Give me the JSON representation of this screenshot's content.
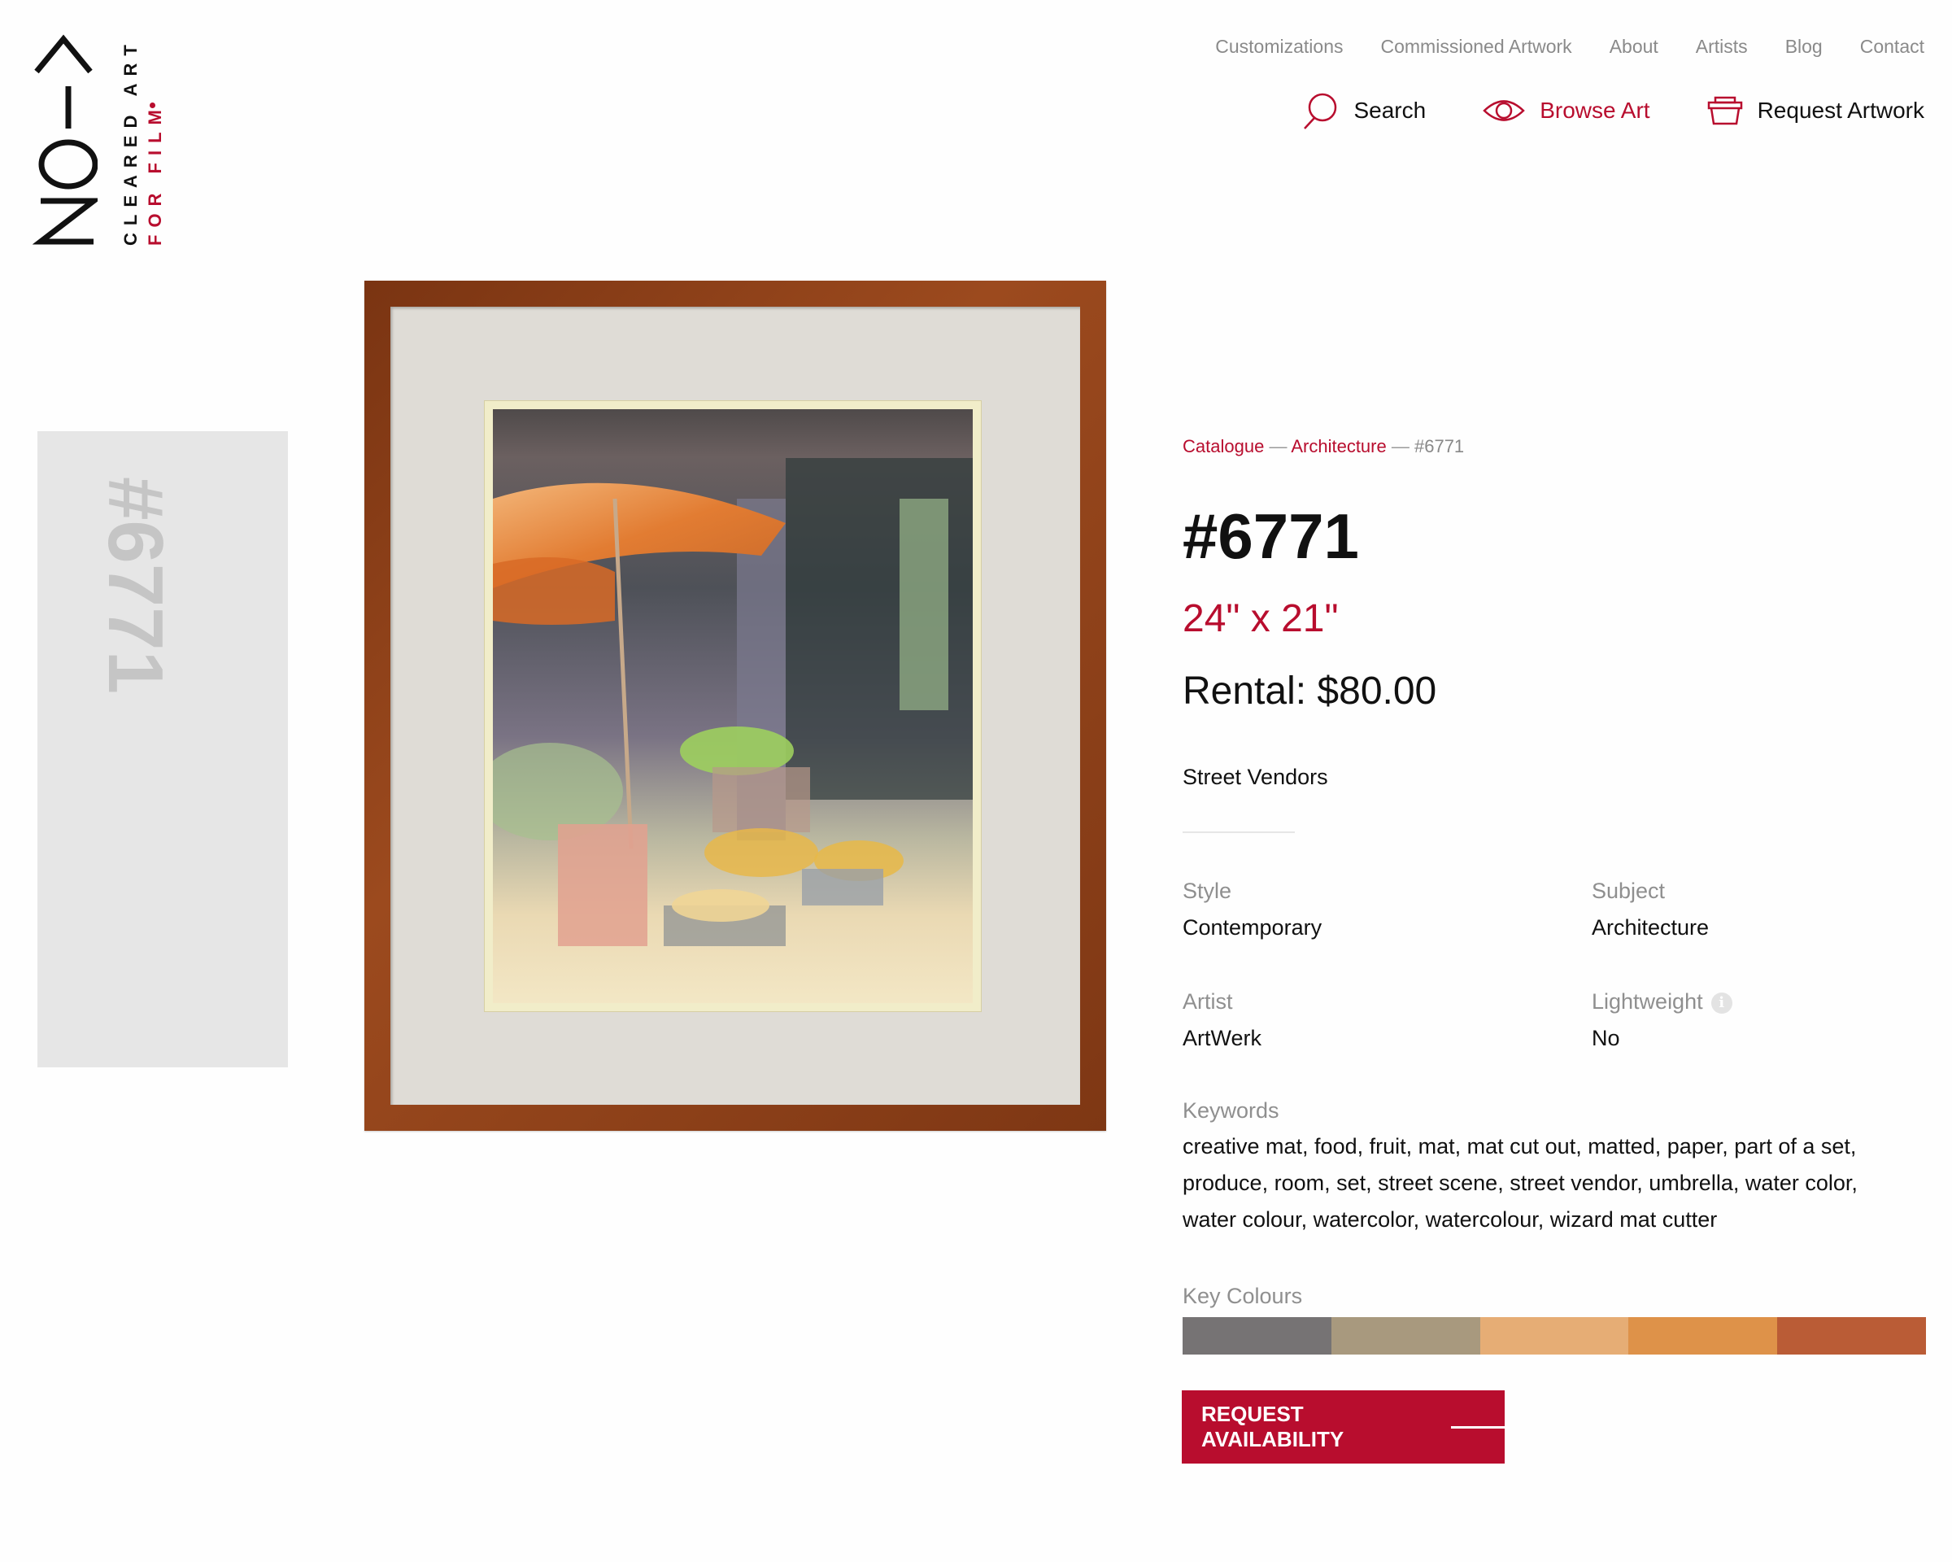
{
  "brand": {
    "tagline_line1": "CLEARED ART",
    "tagline_line2": "FOR FILM",
    "accent_color": "#b80d2e"
  },
  "top_nav": [
    {
      "label": "Customizations"
    },
    {
      "label": "Commissioned Artwork"
    },
    {
      "label": "About"
    },
    {
      "label": "Artists"
    },
    {
      "label": "Blog"
    },
    {
      "label": "Contact"
    }
  ],
  "main_nav": [
    {
      "label": "Search",
      "icon": "search-icon",
      "active": false
    },
    {
      "label": "Browse Art",
      "icon": "eye-icon",
      "active": true
    },
    {
      "label": "Request Artwork",
      "icon": "basket-icon",
      "active": false
    }
  ],
  "side_id": "#6771",
  "breadcrumb": {
    "items": [
      "Catalogue",
      "Architecture"
    ],
    "separator": "—",
    "current": "#6771"
  },
  "artwork": {
    "id": "#6771",
    "size": "24\" x 21\"",
    "rental": "Rental: $80.00",
    "title": "Street Vendors",
    "image_alt": "Framed watercolor of a street vendor stall with an orange umbrella and baskets of fruit"
  },
  "attributes": [
    {
      "label": "Style",
      "value": "Contemporary"
    },
    {
      "label": "Subject",
      "value": "Architecture"
    },
    {
      "label": "Artist",
      "value": "ArtWerk"
    },
    {
      "label": "Lightweight",
      "value": "No",
      "has_info": true
    }
  ],
  "keywords": {
    "label": "Keywords",
    "value": "creative mat, food, fruit, mat, mat cut out, matted, paper, part of a set, produce, room, set, street scene, street vendor, umbrella, water color, water colour, watercolor, watercolour, wizard mat cutter"
  },
  "key_colours": {
    "label": "Key Colours",
    "swatches": [
      "#767374",
      "#a8997e",
      "#e6ad75",
      "#de9249",
      "#ba5c36"
    ]
  },
  "cta": {
    "label": "REQUEST AVAILABILITY"
  }
}
